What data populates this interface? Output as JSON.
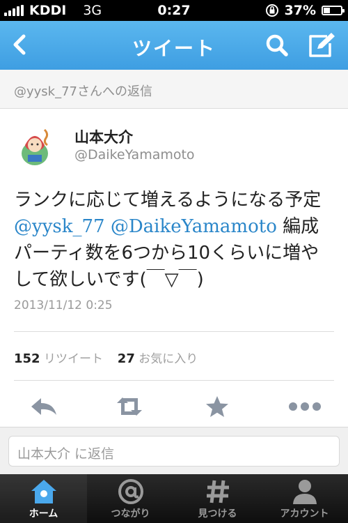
{
  "status_bar": {
    "carrier": "KDDI",
    "network": "3G",
    "time": "0:27",
    "battery_percent": "37%",
    "battery_level": 0.37
  },
  "nav": {
    "title": "ツイート",
    "back_icon": "chevron-left-icon",
    "search_icon": "search-icon",
    "compose_icon": "compose-icon"
  },
  "reply_to": "@yysk_77さんへの返信",
  "tweet": {
    "author_name": "山本大介",
    "author_handle": "@DaikeYamamoto",
    "text_before": "ランクに応じて増えるようになる予定 ",
    "mention1": "@yysk_77",
    "mention2": "@DaikeYamamoto",
    "text_after": " 編成パーティ数を6つから10くらいに増やして欲しいです(￣▽￣)",
    "timestamp": "2013/11/12 0:25"
  },
  "stats": {
    "retweets_count": "152",
    "retweets_label": "リツイート",
    "favorites_count": "27",
    "favorites_label": "お気に入り"
  },
  "actions": [
    "reply-icon",
    "retweet-icon",
    "star-icon",
    "more-icon"
  ],
  "reply_box": {
    "placeholder": "山本大介 に返信"
  },
  "tabs": [
    {
      "label": "ホーム",
      "icon": "home-icon"
    },
    {
      "label": "つながり",
      "icon": "at-icon"
    },
    {
      "label": "見つける",
      "icon": "hash-icon"
    },
    {
      "label": "アカウント",
      "icon": "person-icon"
    }
  ],
  "colors": {
    "nav_blue": "#3e9ee2",
    "link_blue": "#2a86c9",
    "active_tab_icon": "#4aa8ec"
  }
}
